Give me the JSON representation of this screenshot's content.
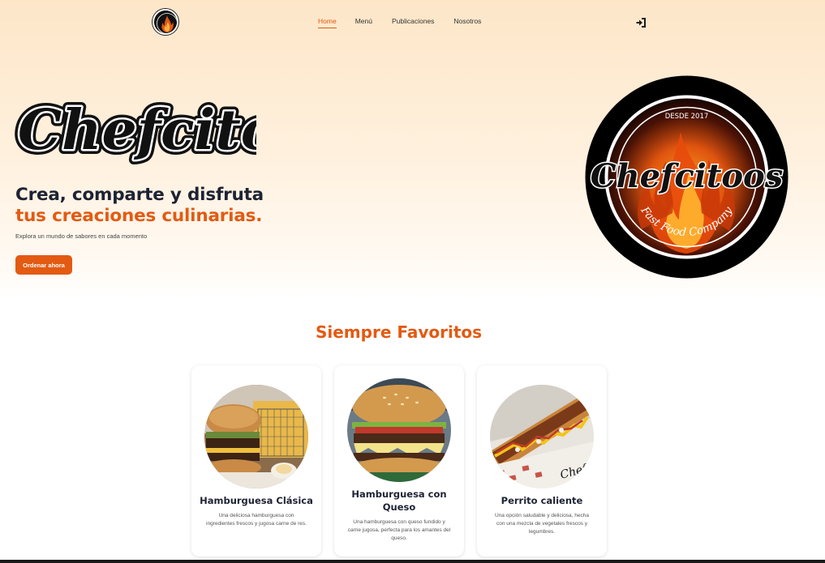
{
  "brand": {
    "name": "Chefcitoos",
    "emblem_top_text": "DESDE 2017",
    "emblem_bottom_text": "Fast Food Company"
  },
  "nav": {
    "links": [
      {
        "label": "Home",
        "active": true
      },
      {
        "label": "Menú",
        "active": false
      },
      {
        "label": "Publicaciones",
        "active": false
      },
      {
        "label": "Nosotros",
        "active": false
      }
    ],
    "login_icon": "sign-in-icon"
  },
  "hero": {
    "title_line1": "Crea, comparte y disfruta",
    "title_line2": "tus creaciones culinarias.",
    "subtitle": "Explora un mundo de sabores en cada momento",
    "cta_label": "Ordenar ahora"
  },
  "favorites": {
    "title": "Siempre Favoritos",
    "items": [
      {
        "name": "Hamburguesa Clásica",
        "description": "Una deliciosa hamburguesa con ingredientes frescos y jugosa carne de res.",
        "image": "classic-burger-photo"
      },
      {
        "name": "Hamburguesa con Queso",
        "description": "Una hamburguesa con queso fundido y carne jugosa, perfecta para los amantes del queso.",
        "image": "cheeseburger-photo"
      },
      {
        "name": "Perrito caliente",
        "description": "Una opción saludable y deliciosa, hecha con una mezcla de vegetales frescos y legumbres.",
        "image": "hot-dog-photo"
      }
    ]
  },
  "colors": {
    "accent": "#e35a12",
    "heading": "#1e2333",
    "hero_bg_top": "#fde6c8"
  }
}
